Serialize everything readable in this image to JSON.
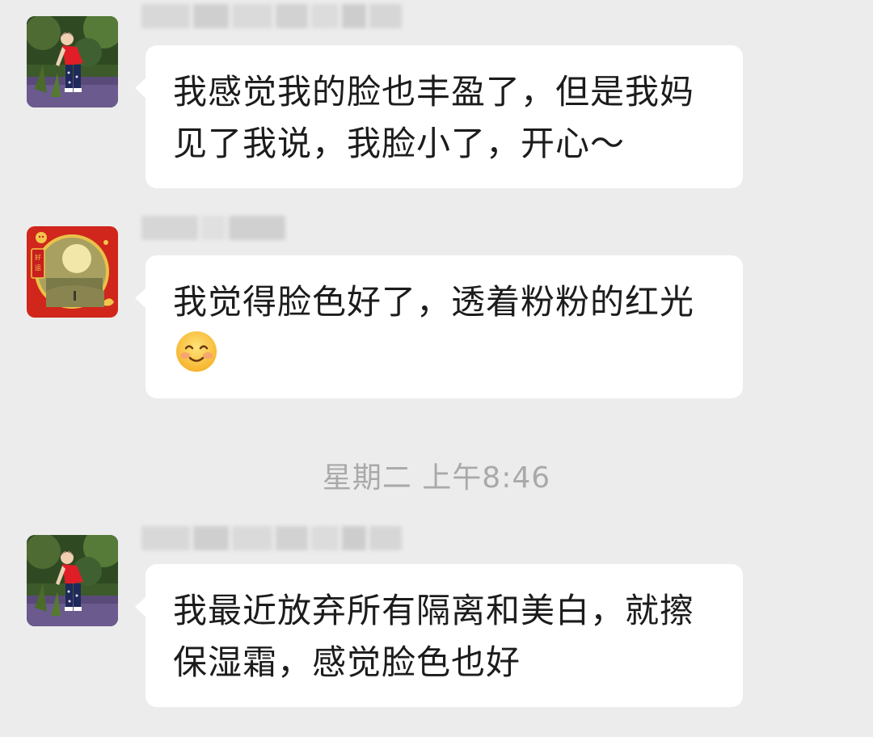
{
  "chat": {
    "messages": [
      {
        "avatar": "avatar-girl-in-garden",
        "sender_blurred": true,
        "text": "我感觉我的脸也丰盈了，但是我妈见了我说，我脸小了，开心～"
      },
      {
        "avatar": "avatar-haoyun-red-frame",
        "sender_blurred": true,
        "text": "我觉得脸色好了，透着粉粉的红光",
        "emoji": "smiling-face-emoji"
      },
      {
        "avatar": "avatar-girl-in-garden",
        "sender_blurred": true,
        "text": "我最近放弃所有隔离和美白，就擦保湿霜，感觉脸色也好"
      }
    ],
    "timestamp": "星期二 上午8:46",
    "avatar_badge_text": "好运"
  },
  "colors": {
    "background": "#ececec",
    "bubble": "#ffffff",
    "text": "#1c1c1c",
    "timestamp": "#a9a9a9"
  }
}
